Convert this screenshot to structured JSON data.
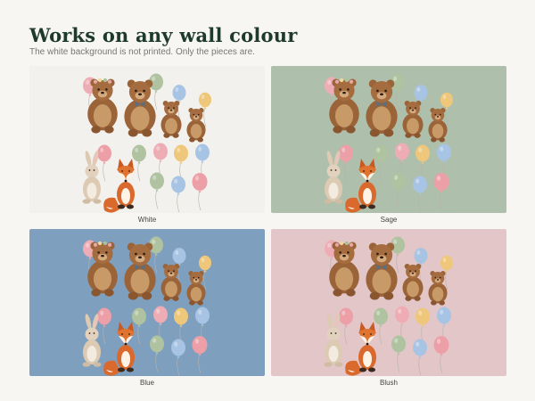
{
  "header": {
    "title": "Works on any wall colour",
    "subtitle": "The white background is not printed. Only the pieces are."
  },
  "swatches": [
    {
      "label": "White",
      "color": "#f3f1ed"
    },
    {
      "label": "Sage",
      "color": "#aebfab"
    },
    {
      "label": "Blue",
      "color": "#7f9fbf"
    },
    {
      "label": "Blush",
      "color": "#e2c6c8"
    }
  ],
  "balloon_colors": {
    "pink": "#eeadb4",
    "sage": "#afc3a0",
    "blue": "#a8c4e4",
    "yellow": "#efc77a",
    "coral": "#ec9fa7"
  }
}
